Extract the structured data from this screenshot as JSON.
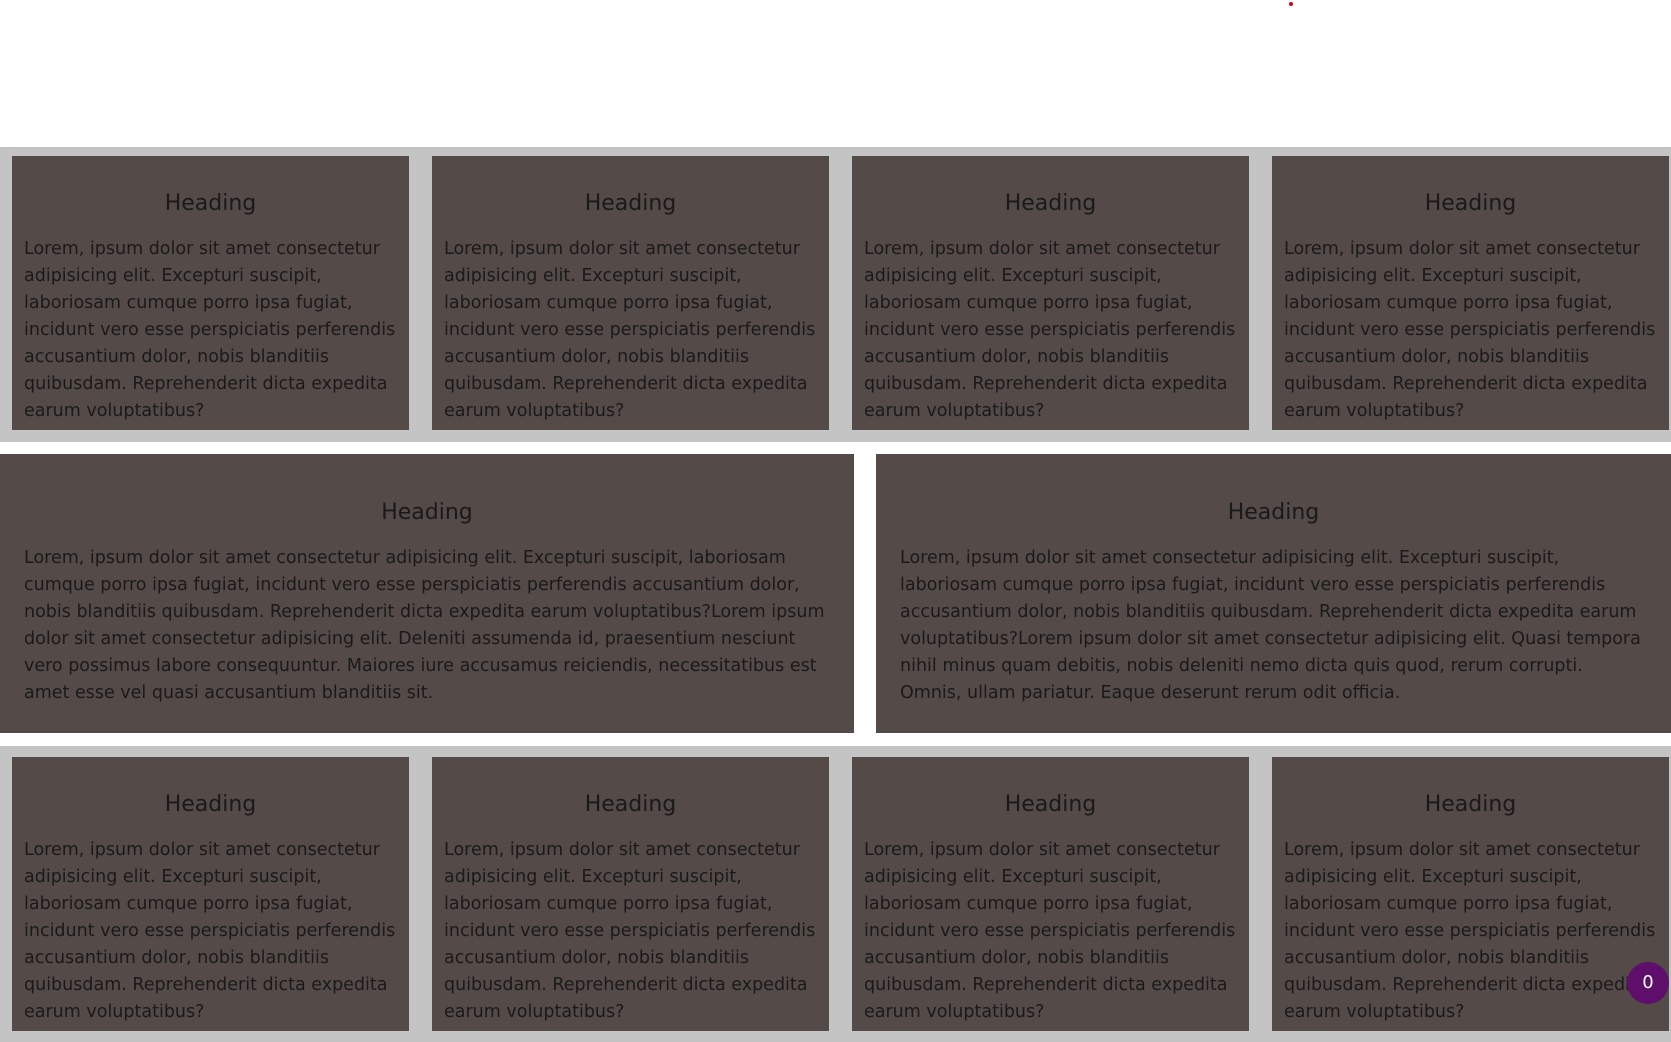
{
  "colors": {
    "card_background": "#544a48",
    "band_background": "#c4c4c4",
    "page_background": "#ffffff",
    "badge_background": "#5e0e6b",
    "dot_color": "#d0021b"
  },
  "top_row": [
    {
      "heading": "Heading",
      "body": "Lorem, ipsum dolor sit amet consectetur adipisicing elit. Excepturi suscipit, laboriosam cumque porro ipsa fugiat, incidunt vero esse perspiciatis perferendis accusantium dolor, nobis blanditiis quibusdam. Reprehenderit dicta expedita earum voluptatibus?"
    },
    {
      "heading": "Heading",
      "body": "Lorem, ipsum dolor sit amet consectetur adipisicing elit. Excepturi suscipit, laboriosam cumque porro ipsa fugiat, incidunt vero esse perspiciatis perferendis accusantium dolor, nobis blanditiis quibusdam. Reprehenderit dicta expedita earum voluptatibus?"
    },
    {
      "heading": "Heading",
      "body": "Lorem, ipsum dolor sit amet consectetur adipisicing elit. Excepturi suscipit, laboriosam cumque porro ipsa fugiat, incidunt vero esse perspiciatis perferendis accusantium dolor, nobis blanditiis quibusdam. Reprehenderit dicta expedita earum voluptatibus?"
    },
    {
      "heading": "Heading",
      "body": "Lorem, ipsum dolor sit amet consectetur adipisicing elit. Excepturi suscipit, laboriosam cumque porro ipsa fugiat, incidunt vero esse perspiciatis perferendis accusantium dolor, nobis blanditiis quibusdam. Reprehenderit dicta expedita earum voluptatibus?"
    }
  ],
  "middle_row": [
    {
      "heading": "Heading",
      "body": "Lorem, ipsum dolor sit amet consectetur adipisicing elit. Excepturi suscipit, laboriosam cumque porro ipsa fugiat, incidunt vero esse perspiciatis perferendis accusantium dolor, nobis blanditiis quibusdam. Reprehenderit dicta expedita earum voluptatibus?Lorem ipsum dolor sit amet consectetur adipisicing elit. Deleniti assumenda id, praesentium nesciunt vero possimus labore consequuntur. Maiores iure accusamus reiciendis, necessitatibus est amet esse vel quasi accusantium blanditiis sit."
    },
    {
      "heading": "Heading",
      "body": "Lorem, ipsum dolor sit amet consectetur adipisicing elit. Excepturi suscipit, laboriosam cumque porro ipsa fugiat, incidunt vero esse perspiciatis perferendis accusantium dolor, nobis blanditiis quibusdam. Reprehenderit dicta expedita earum voluptatibus?Lorem ipsum dolor sit amet consectetur adipisicing elit. Quasi tempora nihil minus quam debitis, nobis deleniti nemo dicta quis quod, rerum corrupti. Omnis, ullam pariatur. Eaque deserunt rerum odit officia."
    }
  ],
  "bottom_row": [
    {
      "heading": "Heading",
      "body": "Lorem, ipsum dolor sit amet consectetur adipisicing elit. Excepturi suscipit, laboriosam cumque porro ipsa fugiat, incidunt vero esse perspiciatis perferendis accusantium dolor, nobis blanditiis quibusdam. Reprehenderit dicta expedita earum voluptatibus?"
    },
    {
      "heading": "Heading",
      "body": "Lorem, ipsum dolor sit amet consectetur adipisicing elit. Excepturi suscipit, laboriosam cumque porro ipsa fugiat, incidunt vero esse perspiciatis perferendis accusantium dolor, nobis blanditiis quibusdam. Reprehenderit dicta expedita earum voluptatibus?"
    },
    {
      "heading": "Heading",
      "body": "Lorem, ipsum dolor sit amet consectetur adipisicing elit. Excepturi suscipit, laboriosam cumque porro ipsa fugiat, incidunt vero esse perspiciatis perferendis accusantium dolor, nobis blanditiis quibusdam. Reprehenderit dicta expedita earum voluptatibus?"
    },
    {
      "heading": "Heading",
      "body": "Lorem, ipsum dolor sit amet consectetur adipisicing elit. Excepturi suscipit, laboriosam cumque porro ipsa fugiat, incidunt vero esse perspiciatis perferendis accusantium dolor, nobis blanditiis quibusdam. Reprehenderit dicta expedita earum voluptatibus?"
    }
  ],
  "badge": {
    "count": "0"
  }
}
